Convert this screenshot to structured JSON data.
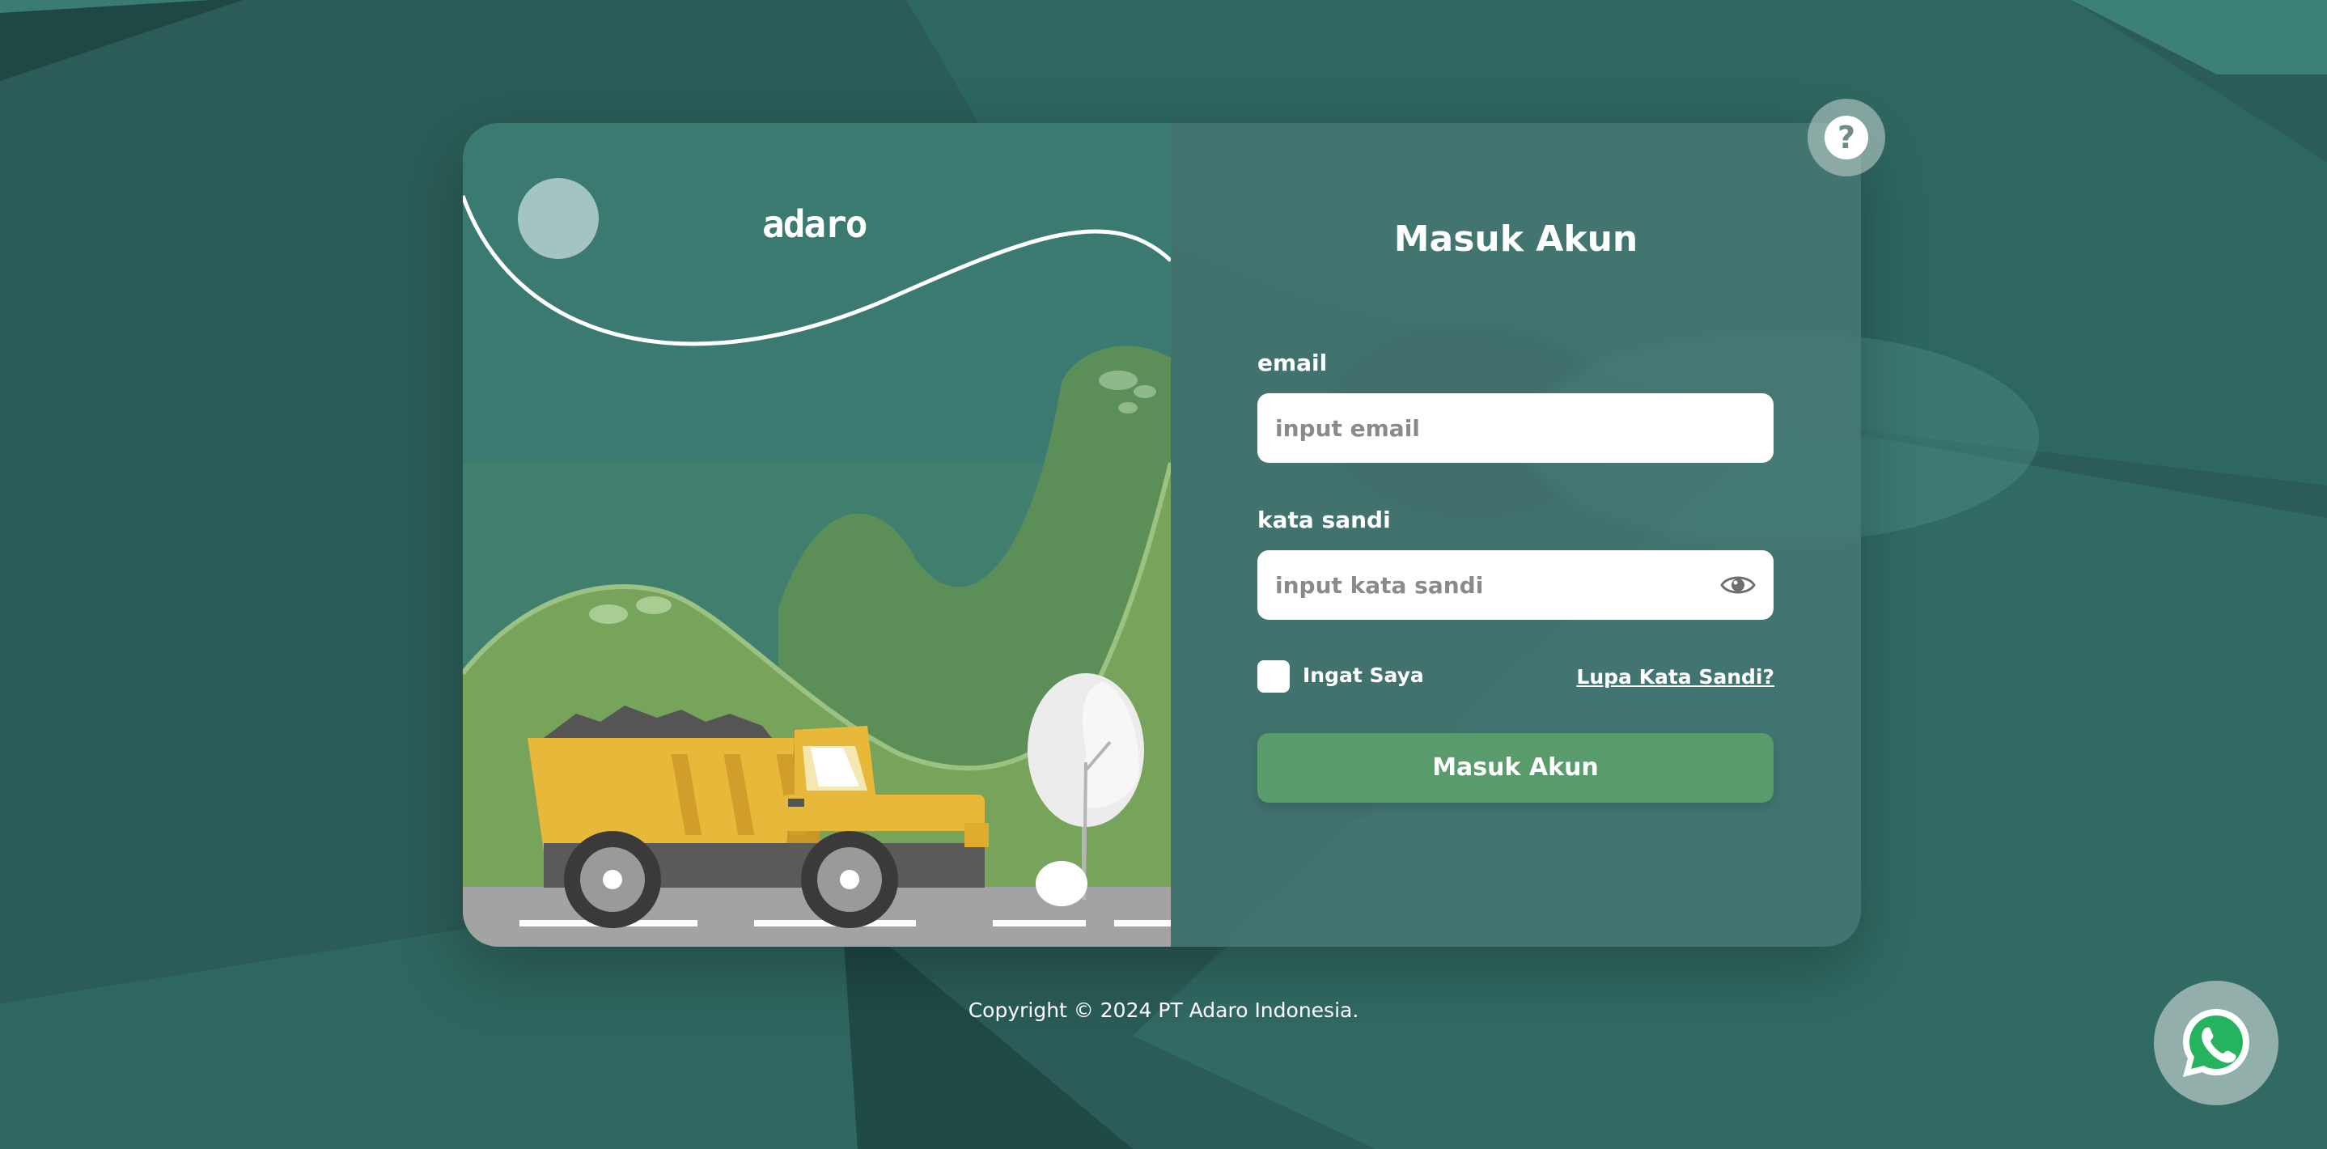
{
  "brand": {
    "logo_text": "adaro"
  },
  "login": {
    "title": "Masuk Akun",
    "email_label": "email",
    "email_placeholder": "input email",
    "password_label": "kata sandi",
    "password_placeholder": "input kata sandi",
    "remember_label": "Ingat Saya",
    "forgot_label": "Lupa Kata Sandi?",
    "submit_label": "Masuk Akun"
  },
  "help": {
    "label": "?"
  },
  "footer": {
    "copyright": "Copyright © 2024 PT Adaro Indonesia."
  },
  "icons": {
    "help": "question-circle-icon",
    "password_toggle": "eye-icon",
    "whatsapp": "whatsapp-icon"
  },
  "colors": {
    "background": "#2a5b56",
    "card_left": "#3a7a70",
    "card_right": "#487874",
    "accent_button": "#5a9b6c",
    "hill": "#7da45a"
  }
}
